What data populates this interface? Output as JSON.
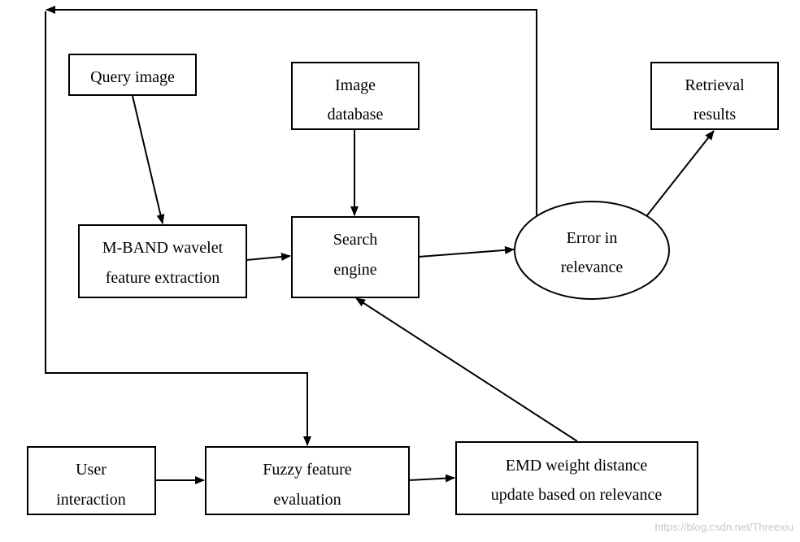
{
  "nodes": {
    "query_image": {
      "lines": [
        "Query image"
      ]
    },
    "image_database": {
      "lines": [
        "Image",
        "database"
      ]
    },
    "retrieval_results": {
      "lines": [
        "Retrieval",
        "results"
      ]
    },
    "mband": {
      "lines": [
        "M-BAND wavelet",
        "feature extraction"
      ]
    },
    "search_engine": {
      "lines": [
        "Search",
        "engine"
      ]
    },
    "error_relevance": {
      "lines": [
        "Error in",
        "relevance"
      ]
    },
    "user_interaction": {
      "lines": [
        "User",
        "interaction"
      ]
    },
    "fuzzy": {
      "lines": [
        "Fuzzy feature",
        "evaluation"
      ]
    },
    "emd": {
      "lines": [
        "EMD weight distance",
        "update based on relevance"
      ]
    }
  },
  "watermark": "https://blog.csdn.net/Threexiu"
}
